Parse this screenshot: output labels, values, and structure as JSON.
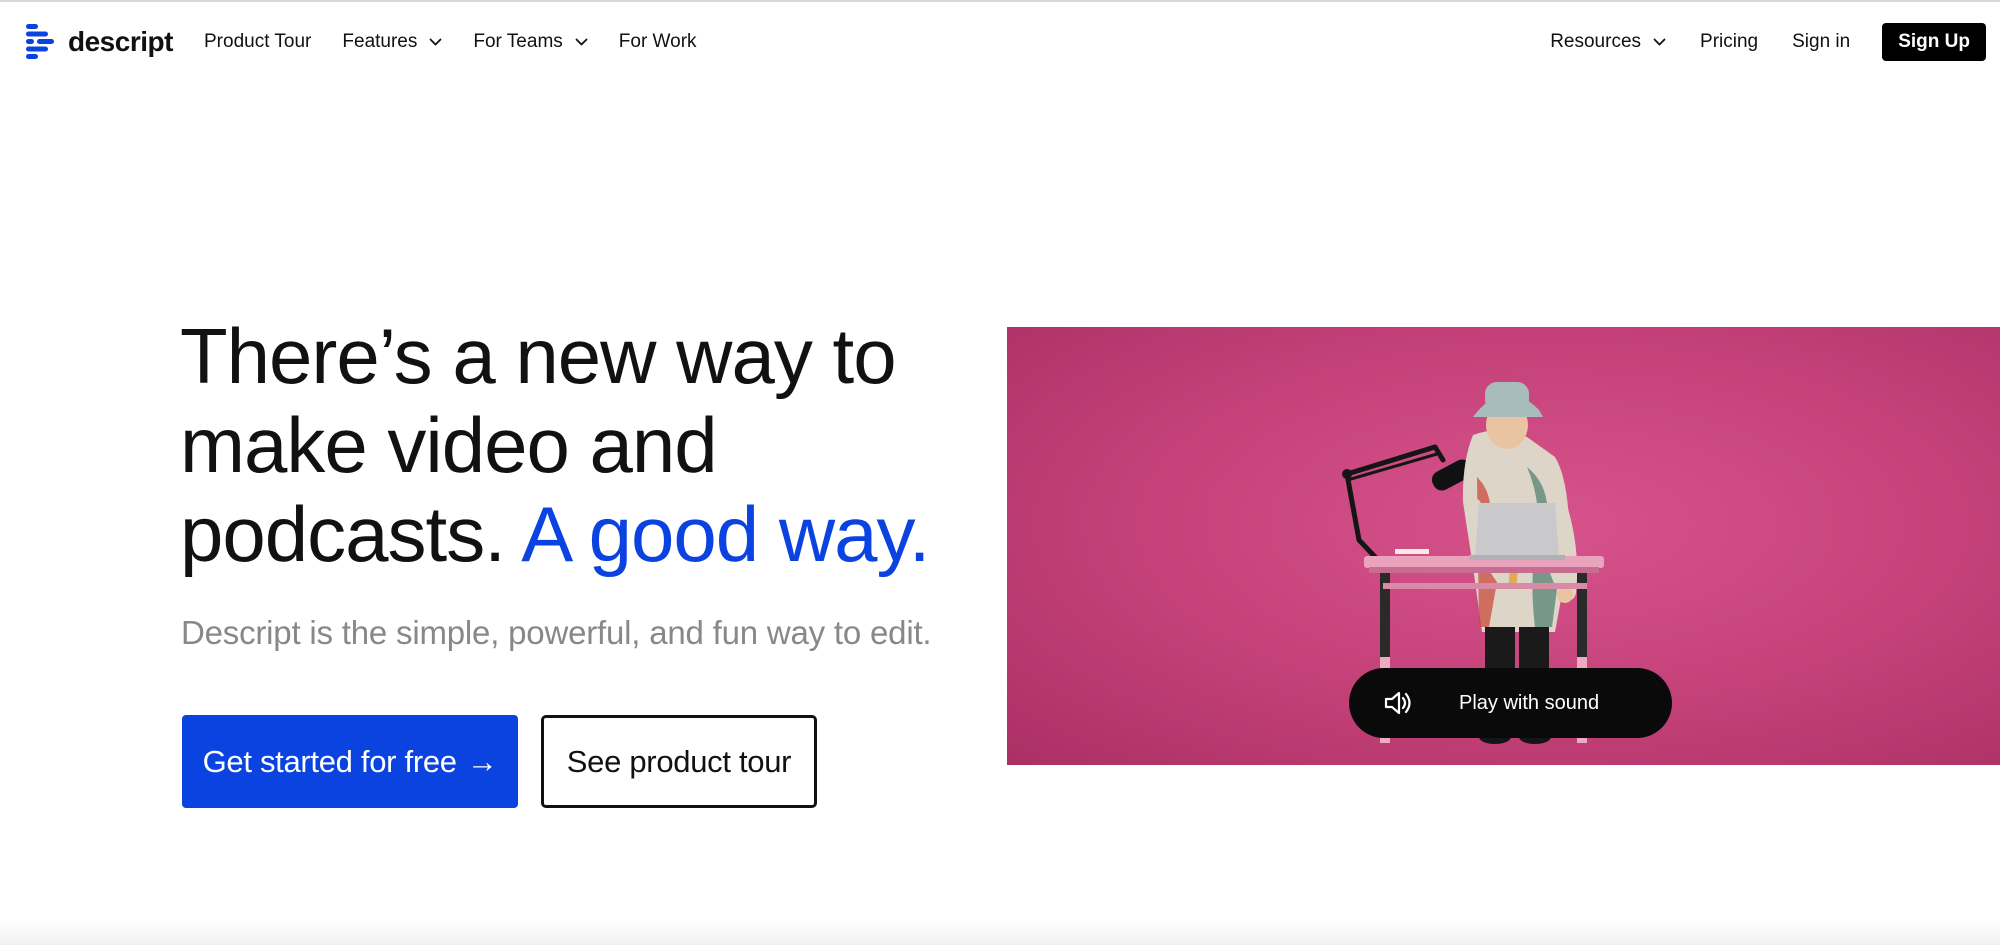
{
  "brand": {
    "name": "descript",
    "accent_color": "#0b43e0",
    "logo_icon": "descript-logo-icon"
  },
  "nav": {
    "left": [
      {
        "label": "Product Tour",
        "has_dropdown": false
      },
      {
        "label": "Features",
        "has_dropdown": true
      },
      {
        "label": "For Teams",
        "has_dropdown": true
      },
      {
        "label": "For Work",
        "has_dropdown": false
      }
    ],
    "right": [
      {
        "label": "Resources",
        "has_dropdown": true
      },
      {
        "label": "Pricing",
        "has_dropdown": false
      },
      {
        "label": "Sign in",
        "has_dropdown": false
      }
    ],
    "signup_label": "Sign Up"
  },
  "hero": {
    "headline_main": "There’s a new way to make video and podcasts.",
    "headline_accent": "A good way.",
    "subhead": "Descript is the simple, powerful, and fun way to edit.",
    "primary_cta": "Get started for free",
    "primary_cta_icon": "→",
    "secondary_cta": "See product tour"
  },
  "video": {
    "background_color": "#cc4080",
    "play_label": "Play with sound",
    "play_icon": "speaker-icon"
  }
}
